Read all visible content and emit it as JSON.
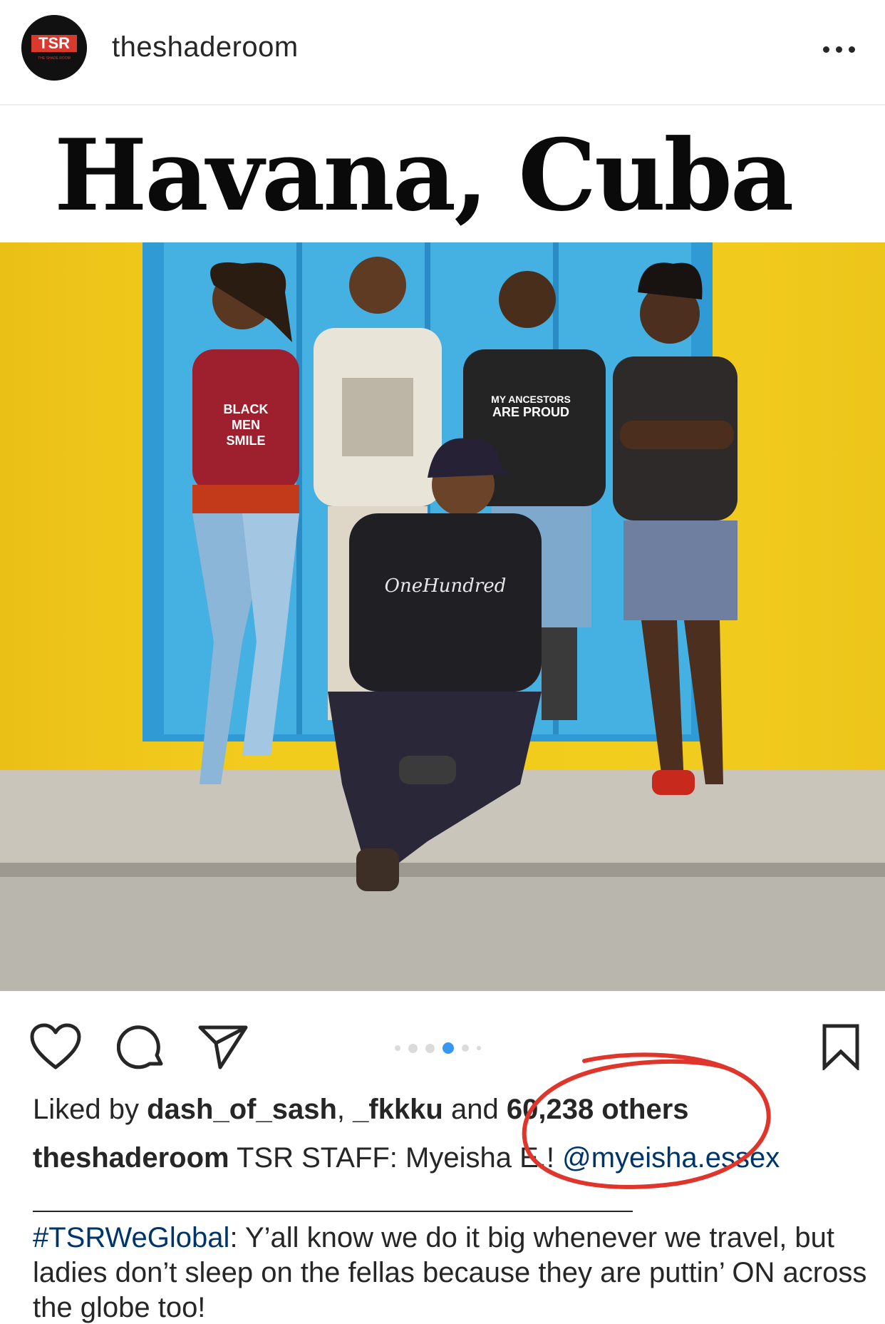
{
  "header": {
    "avatar_text": "TSR",
    "avatar_subtext": "THE SHADE ROOM",
    "username": "theshaderoom"
  },
  "media": {
    "title": "Havana, Cuba",
    "shirt_text_1": "BLACK MEN SMILE",
    "shirt_text_2": "MY ANCESTORS ARE PROUD",
    "shirt_text_3": "OneHundred",
    "carousel": {
      "count": 6,
      "active_index": 3
    }
  },
  "actions": {
    "like_icon": "heart-icon",
    "comment_icon": "comment-icon",
    "share_icon": "paper-plane-icon",
    "save_icon": "bookmark-icon"
  },
  "likes": {
    "prefix": "Liked by ",
    "user1": "dash_of_sash",
    "separator": ", ",
    "user2": "_fkkku",
    "and": " and ",
    "others": "60,238 others"
  },
  "caption": {
    "author": "theshaderoom",
    "text": " TSR STAFF: Myeisha E.! ",
    "mention": "@myeisha.essex",
    "hashtag": "#TSRWeGlobal",
    "body": ": Y’all know we do it big whenever we travel, but ladies don’t sleep on the fellas because they are puttin’ ON across the globe too!"
  },
  "colors": {
    "wall_yellow": "#f2cc1c",
    "door_blue": "#3aa6dc",
    "link_blue": "#003569",
    "carousel_active": "#3897f0",
    "annotation_red": "#e0352b"
  }
}
